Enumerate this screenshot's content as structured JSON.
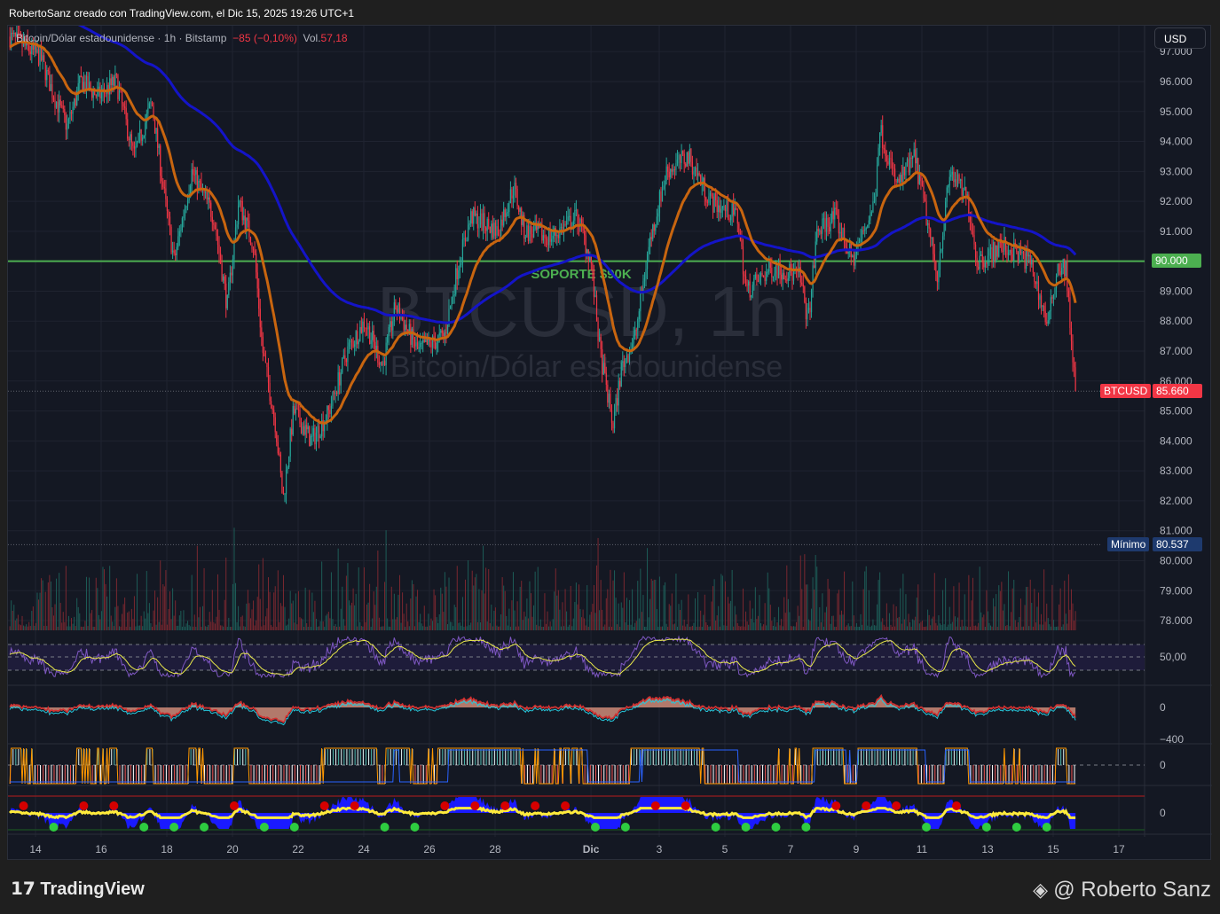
{
  "topbar": {
    "text": "RobertoSanz creado con TradingView.com, el Dic 15, 2025 19:26 UTC+1"
  },
  "legend": {
    "symbol": "Bitcoin/Dólar estadounidense · 1h · Bitstamp",
    "change": "−85 (−0,10%)",
    "vol_label": "Vol.",
    "vol_value": "57,18"
  },
  "currency_button": "USD",
  "labels": {
    "support_line_price": "90.000",
    "last_symbol": "BTCUSD",
    "last_price": "85.660",
    "min_label": "Mínimo",
    "min_price": "80.537"
  },
  "footer": {
    "brand": "TradingView",
    "author": "@ Roberto Sanz"
  },
  "colors": {
    "up": "#26a69a",
    "down": "#f23645",
    "support": "#4caf50",
    "ma_fast": "#c8650f",
    "ma_slow": "#1414c8",
    "min_label": "#1e3a6e"
  },
  "chart_data": {
    "type": "line",
    "title": "BTCUSD, 1h",
    "subtitle": "Bitcoin/Dólar estadounidense",
    "annotation": "SOPORTE $90K",
    "support_level": 90000,
    "last_price": 85660,
    "minimum": 80537,
    "ylim": [
      77600,
      97700
    ],
    "y_ticks": [
      97000,
      96000,
      95000,
      94000,
      93000,
      92000,
      91000,
      90000,
      89000,
      88000,
      87000,
      86000,
      85000,
      84000,
      83000,
      82000,
      81000,
      80000,
      79000,
      78000
    ],
    "y_tick_labels": [
      "97.000",
      "96.000",
      "95.000",
      "94.000",
      "93.000",
      "92.000",
      "91.000",
      "90.000",
      "89.000",
      "88.000",
      "87.000",
      "86.000",
      "85.000",
      "84.000",
      "83.000",
      "82.000",
      "81.000",
      "80.000",
      "79.000",
      "78.000"
    ],
    "x_unit": "days since Nov 14",
    "x_tick_labels": [
      "14",
      "16",
      "18",
      "20",
      "22",
      "24",
      "26",
      "28",
      "Dic",
      "3",
      "5",
      "7",
      "9",
      "11",
      "13",
      "15",
      "17"
    ],
    "x_tick_values": [
      0,
      2,
      4,
      6,
      8,
      10,
      12,
      14,
      16.92,
      19,
      21,
      23,
      25,
      27,
      29,
      31,
      33
    ],
    "series": [
      {
        "name": "BTCUSD close path (approx.)",
        "points": [
          [
            -0.78,
            97500
          ],
          [
            0.16,
            96800
          ],
          [
            0.57,
            95500
          ],
          [
            0.97,
            94500
          ],
          [
            1.38,
            96000
          ],
          [
            1.92,
            95500
          ],
          [
            2.46,
            96000
          ],
          [
            3.0,
            93500
          ],
          [
            3.54,
            95300
          ],
          [
            3.95,
            92000
          ],
          [
            4.22,
            90000
          ],
          [
            4.76,
            93000
          ],
          [
            5.43,
            91500
          ],
          [
            5.84,
            88500
          ],
          [
            6.19,
            92000
          ],
          [
            6.65,
            90500
          ],
          [
            6.92,
            87000
          ],
          [
            7.32,
            84500
          ],
          [
            7.54,
            82000
          ],
          [
            7.86,
            85000
          ],
          [
            8.41,
            84000
          ],
          [
            8.95,
            85000
          ],
          [
            9.49,
            87000
          ],
          [
            10.03,
            88000
          ],
          [
            10.57,
            86500
          ],
          [
            10.97,
            88500
          ],
          [
            11.65,
            87000
          ],
          [
            12.46,
            87500
          ],
          [
            12.86,
            89800
          ],
          [
            13.27,
            91500
          ],
          [
            14.08,
            91000
          ],
          [
            14.57,
            92500
          ],
          [
            14.89,
            91000
          ],
          [
            15.7,
            90800
          ],
          [
            16.51,
            91500
          ],
          [
            16.92,
            90000
          ],
          [
            17.19,
            87000
          ],
          [
            17.59,
            84500
          ],
          [
            17.86,
            86500
          ],
          [
            18.27,
            87500
          ],
          [
            18.68,
            90500
          ],
          [
            19.22,
            93000
          ],
          [
            19.89,
            93500
          ],
          [
            20.57,
            92000
          ],
          [
            21.38,
            91500
          ],
          [
            21.65,
            89000
          ],
          [
            22.46,
            89800
          ],
          [
            23.27,
            89500
          ],
          [
            23.54,
            88000
          ],
          [
            23.81,
            91000
          ],
          [
            24.35,
            91500
          ],
          [
            24.89,
            90000
          ],
          [
            25.57,
            92000
          ],
          [
            25.7,
            94500
          ],
          [
            26.24,
            92500
          ],
          [
            26.78,
            93500
          ],
          [
            27.05,
            92000
          ],
          [
            27.46,
            89500
          ],
          [
            27.86,
            93000
          ],
          [
            28.41,
            92000
          ],
          [
            28.68,
            90000
          ],
          [
            29.49,
            90500
          ],
          [
            30.3,
            90000
          ],
          [
            30.84,
            87800
          ],
          [
            31.11,
            89800
          ],
          [
            31.38,
            89800
          ],
          [
            31.51,
            88000
          ],
          [
            31.68,
            85660
          ]
        ]
      }
    ],
    "panes": [
      {
        "name": "oscillator-1",
        "y_tick_labels": [
          "50,00"
        ]
      },
      {
        "name": "oscillator-2",
        "y_tick_labels": [
          "0",
          "−400"
        ]
      },
      {
        "name": "oscillator-3",
        "y_tick_labels": [
          "0"
        ]
      },
      {
        "name": "oscillator-4",
        "y_tick_labels": [
          "0"
        ]
      }
    ]
  }
}
